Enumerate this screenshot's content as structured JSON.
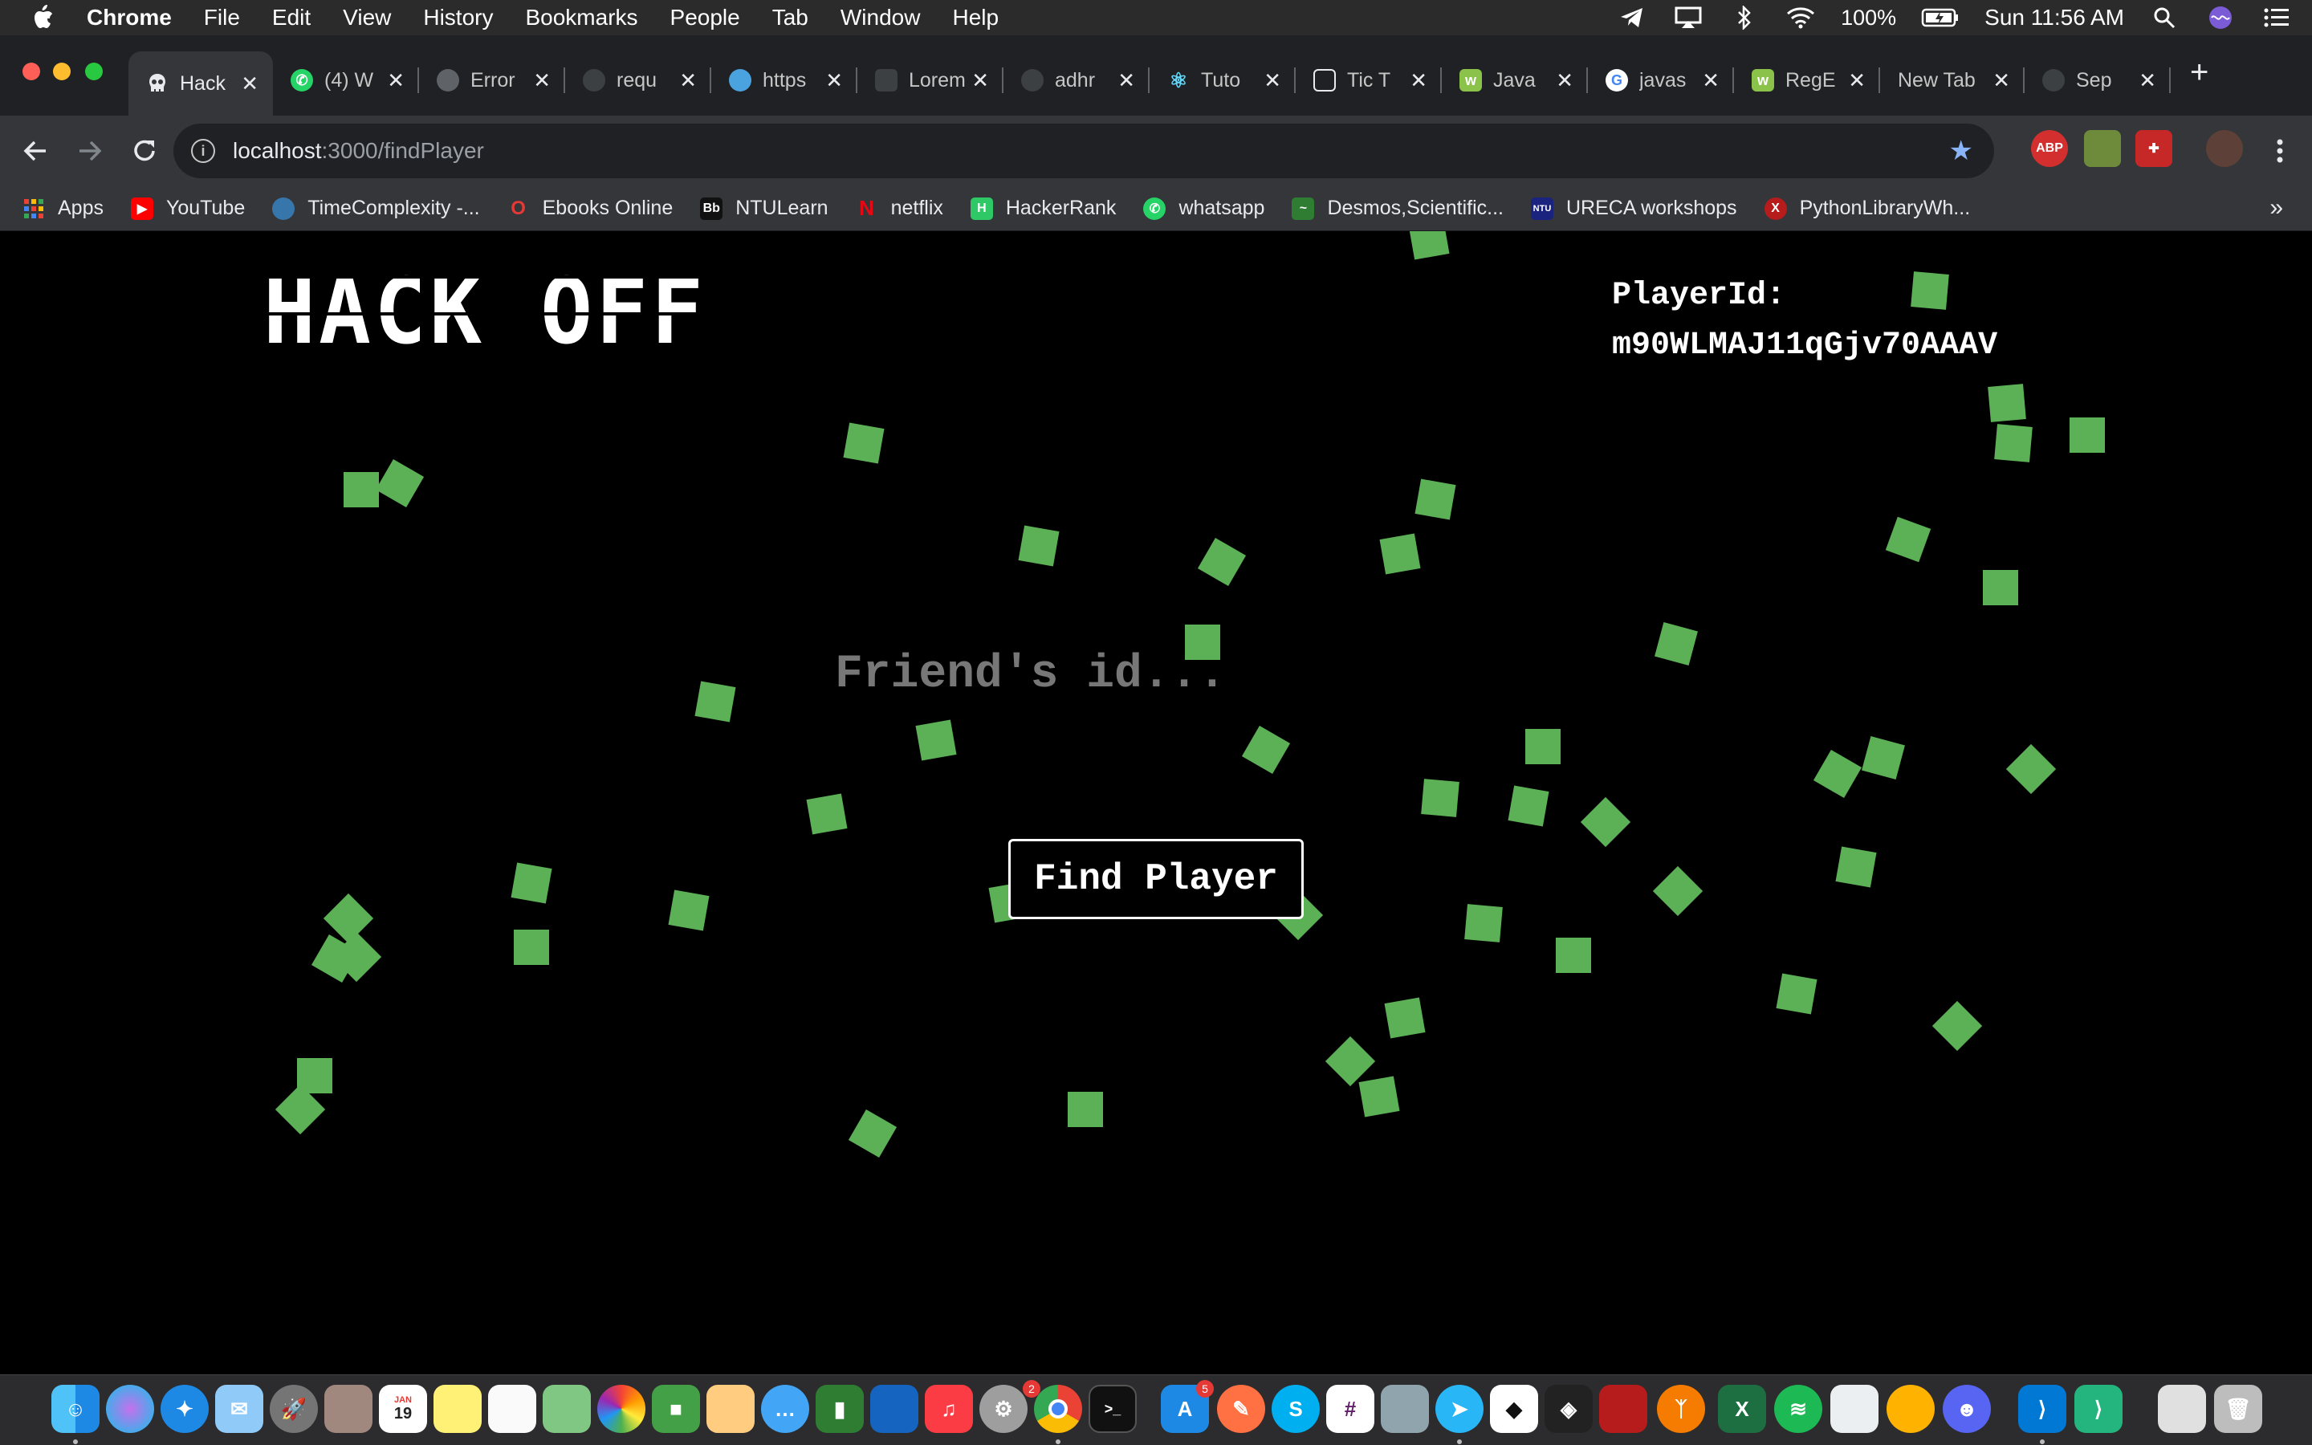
{
  "menubar": {
    "app_name": "Chrome",
    "menus": [
      "File",
      "Edit",
      "View",
      "History",
      "Bookmarks",
      "People",
      "Tab",
      "Window",
      "Help"
    ],
    "battery": "100%",
    "clock": "Sun 11:56 AM"
  },
  "tabs": [
    {
      "title": "Hack",
      "favicon_color": "#35363a",
      "active": true
    },
    {
      "title": "(4) W",
      "favicon_color": "#25d366"
    },
    {
      "title": "Error",
      "favicon_color": "#5f6368"
    },
    {
      "title": "requ",
      "favicon_color": "#3c4043"
    },
    {
      "title": "https",
      "favicon_color": "#4aa3df"
    },
    {
      "title": "Lorem",
      "favicon_color": "#3c4043"
    },
    {
      "title": "adhr",
      "favicon_color": "#3c4043"
    },
    {
      "title": "Tuto",
      "favicon_color": "#61dafb"
    },
    {
      "title": "Tic T",
      "favicon_color": "#202124"
    },
    {
      "title": "Java",
      "favicon_color": "#8bc34a"
    },
    {
      "title": "javas",
      "favicon_color": "#ffffff"
    },
    {
      "title": "RegE",
      "favicon_color": "#8bc34a"
    },
    {
      "title": "New Tab",
      "favicon_color": ""
    },
    {
      "title": "Sep",
      "favicon_color": "#3c4043"
    }
  ],
  "toolbar": {
    "url_host": "localhost",
    "url_path": ":3000/findPlayer"
  },
  "bookmarks": [
    {
      "label": "Apps",
      "color": "#ea4335"
    },
    {
      "label": "YouTube",
      "color": "#ff0000"
    },
    {
      "label": "TimeComplexity -...",
      "color": "#3776ab"
    },
    {
      "label": "Ebooks Online",
      "color": "#e53935"
    },
    {
      "label": "NTULearn",
      "color": "#111111"
    },
    {
      "label": "netflix",
      "color": "#e50914"
    },
    {
      "label": "HackerRank",
      "color": "#2ec866"
    },
    {
      "label": "whatsapp",
      "color": "#25d366"
    },
    {
      "label": "Desmos,Scientific...",
      "color": "#2f7d32"
    },
    {
      "label": "URECA workshops",
      "color": "#1a237e"
    },
    {
      "label": "PythonLibraryWh...",
      "color": "#d32f2f"
    }
  ],
  "page": {
    "logo": "HACK OFF",
    "player_id_label": "PlayerId:",
    "player_id": "m90WLMAJ11qGjv70AAAV",
    "friend_placeholder": "Friend's id...",
    "find_button": "Find Player",
    "square_color": "#5cb056"
  },
  "dock": {
    "calendar_month": "JAN",
    "calendar_day": "19",
    "badges": {
      "preferences": "2",
      "appstore": "5"
    }
  }
}
